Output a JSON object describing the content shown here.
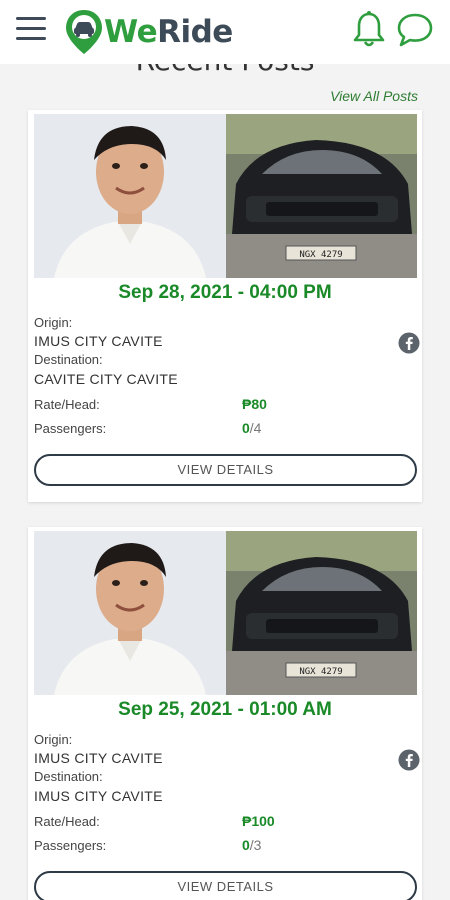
{
  "app": {
    "logo_we": "We",
    "logo_ride": "Ride",
    "brand_color": "#2f9e3e"
  },
  "header": {
    "menu_icon": "hamburger-menu-icon",
    "notification_icon": "bell-icon",
    "messages_icon": "chat-bubble-icon"
  },
  "section": {
    "title": "Recent Posts",
    "view_all": "View All Posts"
  },
  "posts": [
    {
      "date": "Sep 28, 2021 - 04:00 PM",
      "origin_label": "Origin:",
      "origin": "IMUS CITY CAVITE",
      "destination_label": "Destination:",
      "destination": "CAVITE CITY CAVITE",
      "rate_label": "Rate/Head:",
      "rate": "₱80",
      "passengers_label": "Passengers:",
      "passengers_current": "0",
      "passengers_total": "/4",
      "plate": "NGX 4279",
      "share_icon": "facebook-icon",
      "button": "VIEW DETAILS"
    },
    {
      "date": "Sep 25, 2021 - 01:00 AM",
      "origin_label": "Origin:",
      "origin": "IMUS CITY CAVITE",
      "destination_label": "Destination:",
      "destination": "IMUS CITY CAVITE",
      "rate_label": "Rate/Head:",
      "rate": "₱100",
      "passengers_label": "Passengers:",
      "passengers_current": "0",
      "passengers_total": "/3",
      "plate": "NGX 4279",
      "share_icon": "facebook-icon",
      "button": "VIEW DETAILS"
    }
  ]
}
